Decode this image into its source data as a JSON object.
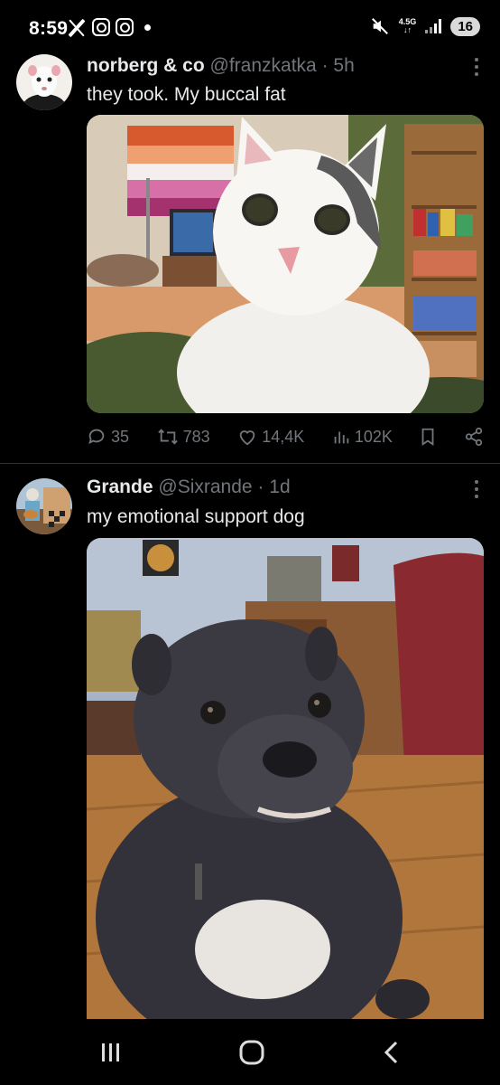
{
  "status_bar": {
    "time": "8:59",
    "network": "4.5G",
    "battery": "16",
    "icons": [
      "x-icon",
      "instagram-icon",
      "instagram-icon",
      "notification-dot",
      "mute-icon",
      "network-icon",
      "signal-icon",
      "battery-icon"
    ]
  },
  "tweets": [
    {
      "name": "norberg & co",
      "handle": "@franzkatka",
      "separator": "·",
      "time": "5h",
      "text": "they took. My buccal fat",
      "media": "photo of white and grey cat close to camera in bedroom",
      "replies": "35",
      "reposts": "783",
      "likes": "14,4K",
      "views": "102K"
    },
    {
      "name": "Grande",
      "handle": "@Sixrande",
      "separator": "·",
      "time": "1d",
      "text": "my emotional support dog",
      "media": "photo of grey pit bull dog sitting on wooden floor"
    }
  ],
  "nav_bar": {
    "buttons": [
      "recent-apps",
      "home",
      "back"
    ]
  },
  "colors": {
    "background": "#000000",
    "primary_text": "#e7e9ea",
    "secondary_text": "#71767b",
    "divider": "#2f3336"
  }
}
